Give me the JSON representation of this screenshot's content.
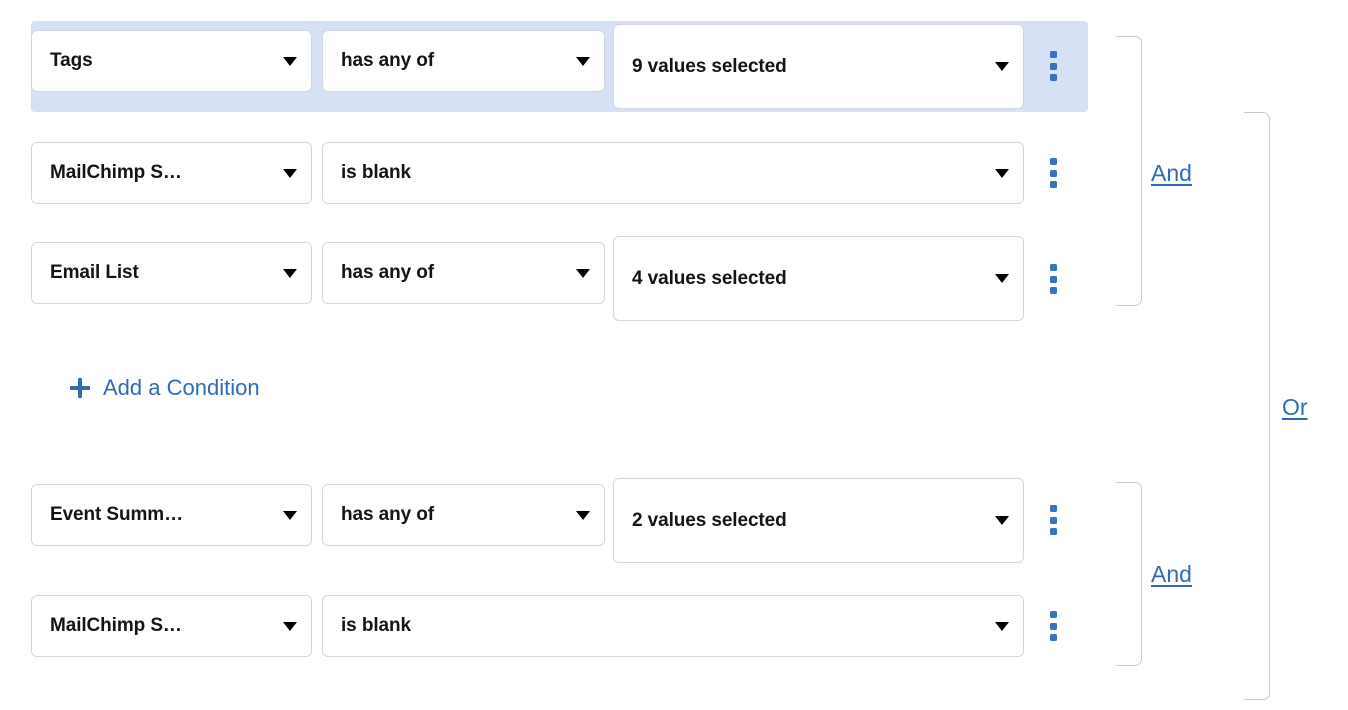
{
  "builder": {
    "add_condition_label": "Add a Condition",
    "add_condition_icon": "plus-icon",
    "row_menu_icon": "kebab-menu-icon",
    "caret_icon": "chevron-down-icon",
    "accent_color": "#2f6cb5",
    "selected_row_color": "#d6e1f5",
    "bracket_color": "#c9cbce",
    "groups": [
      {
        "id": "group-1",
        "conjunction_label": "And",
        "conditions": [
          {
            "id": "condition-1",
            "selected": true,
            "field": "Tags",
            "operator": "has any of",
            "value": "9 values selected",
            "has_value": true
          },
          {
            "id": "condition-2",
            "selected": false,
            "field": "MailChimp S…",
            "operator": "is blank",
            "value": "",
            "has_value": false
          },
          {
            "id": "condition-3",
            "selected": false,
            "field": "Email List",
            "operator": "has any of",
            "value": "4 values selected",
            "has_value": true
          }
        ]
      },
      {
        "id": "group-2",
        "conjunction_label": "And",
        "conditions": [
          {
            "id": "condition-4",
            "selected": false,
            "field": "Event Summ…",
            "operator": "has any of",
            "value": "2 values selected",
            "has_value": true
          },
          {
            "id": "condition-5",
            "selected": false,
            "field": "MailChimp S…",
            "operator": "is blank",
            "value": "",
            "has_value": false
          }
        ]
      }
    ],
    "outer_conjunction_label": "Or"
  }
}
